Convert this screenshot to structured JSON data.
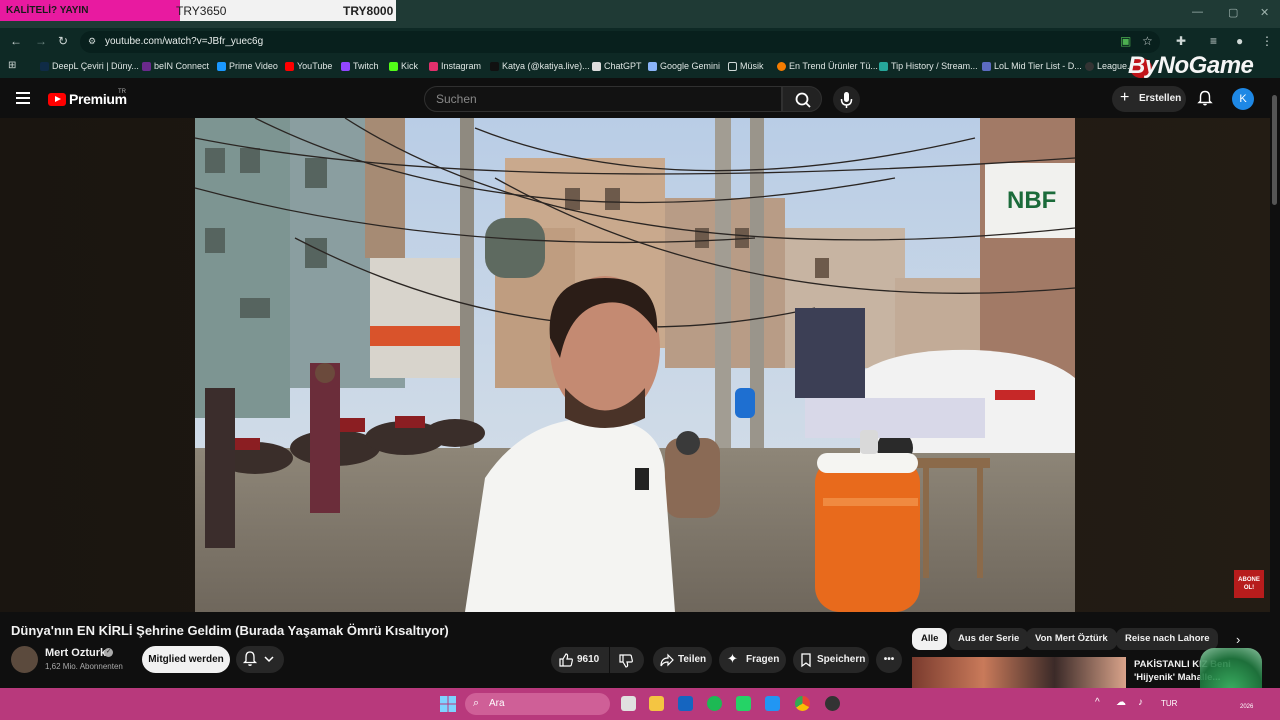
{
  "overlay": {
    "left_text": "KALİTELİ? YAYIN",
    "price1": "TRY3650",
    "price2": "TRY8000"
  },
  "browser": {
    "url": "youtube.com/watch?v=JBfr_yuec6g",
    "bookmarks": [
      "DeepL Çeviri | Düny...",
      "beIN Connect",
      "Prime Video",
      "YouTube",
      "Twitch",
      "Kick",
      "Instagram",
      "Katya (@katiya.live)...",
      "ChatGPT",
      "Google Gemini",
      "Müsik",
      "En Trend Ürünler Tü...",
      "Tip History / Stream...",
      "LoL Mid Tier List - D...",
      "League..."
    ]
  },
  "stream_overlay_brand": "ByNoGame",
  "youtube": {
    "logo": "Premium",
    "region": "TR",
    "search_placeholder": "Suchen",
    "create_label": "Erstellen",
    "avatar_letter": "K"
  },
  "video": {
    "title": "Dünya'nın EN KİRLİ Şehrine Geldim (Burada Yaşamak Ömrü Kısaltıyor)",
    "channel": "Mert Ozturk",
    "subscribers": "1,62 Mio. Abonnenten",
    "member_button": "Mitglied werden",
    "likes": "9610",
    "share": "Teilen",
    "ask": "Fragen",
    "save": "Speichern",
    "overlay_badge": "ABONE OL!"
  },
  "chips": [
    "Alle",
    "Aus der Serie",
    "Von Mert Öztürk",
    "Reise nach Lahore"
  ],
  "recommendation": {
    "title": "PAKİSTANLI KIZ Beni 'Hijyenik' Mahalle..."
  },
  "taskbar": {
    "search_label": "Ara",
    "language": "TUR",
    "year": "2026"
  },
  "colors": {
    "taskbar": "#b8397c",
    "accent_red": "#ff0000",
    "avatar_blue": "#1e88e5"
  }
}
